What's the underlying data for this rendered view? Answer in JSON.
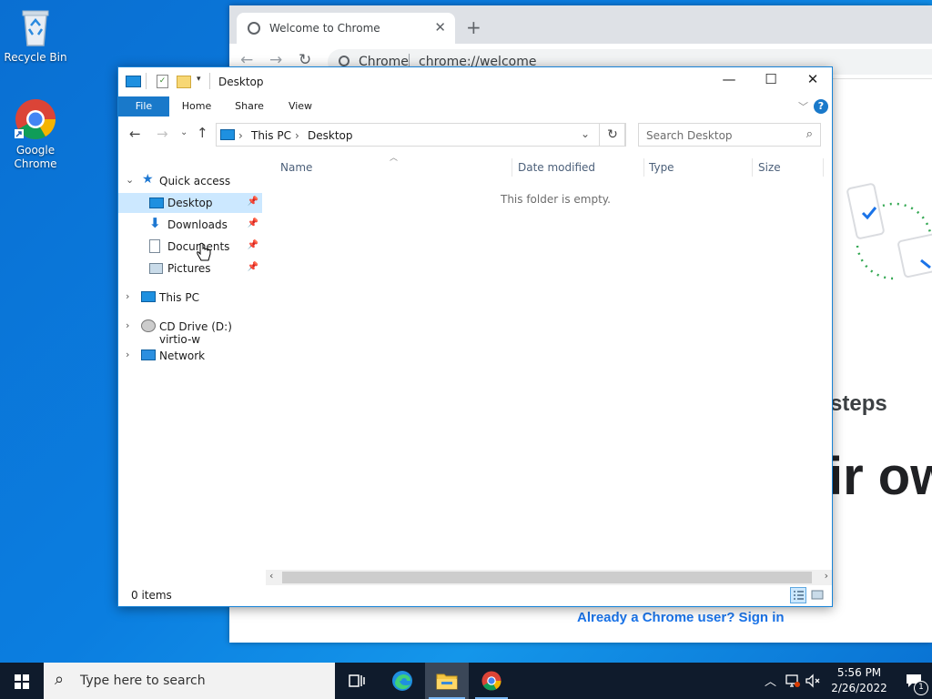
{
  "desktop": {
    "icons": [
      {
        "label": "Recycle Bin"
      },
      {
        "label": "Google Chrome",
        "label_line1": "Google",
        "label_line2": "Chrome"
      }
    ]
  },
  "chrome": {
    "tab_title": "Welcome to Chrome",
    "omnibox_site": "Chrome",
    "omnibox_url": "chrome://welcome",
    "page_text_steps": "steps",
    "page_text_big": "ir ow",
    "signin_link": "Already a Chrome user? Sign in"
  },
  "explorer": {
    "window_title": "Desktop",
    "ribbon_tabs": [
      "File",
      "Home",
      "Share",
      "View"
    ],
    "breadcrumb": [
      "This PC",
      "Desktop"
    ],
    "search_placeholder": "Search Desktop",
    "nav": {
      "quick_access": "Quick access",
      "items": [
        "Desktop",
        "Downloads",
        "Documents",
        "Pictures"
      ],
      "this_pc": "This PC",
      "cd_drive": "CD Drive (D:) virtio-w",
      "network": "Network"
    },
    "columns": [
      "Name",
      "Date modified",
      "Type",
      "Size"
    ],
    "empty_text": "This folder is empty.",
    "status": "0 items"
  },
  "taskbar": {
    "search_placeholder": "Type here to search",
    "time": "5:56 PM",
    "date": "2/26/2022",
    "notification_count": "1"
  },
  "colors": {
    "accent": "#1979ca",
    "selection": "#cce8ff",
    "taskbar": "#0f1b2c",
    "desktop": "#0b7ee0"
  }
}
